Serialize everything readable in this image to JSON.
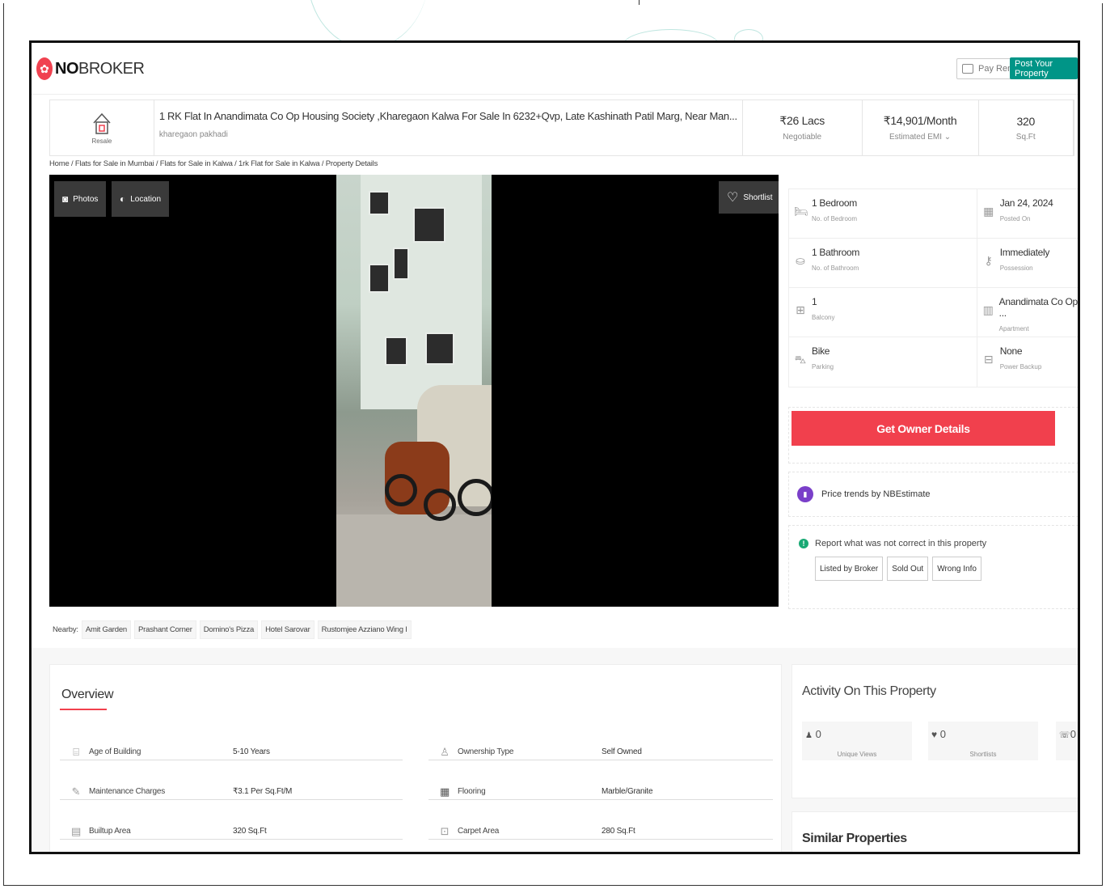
{
  "header": {
    "logo_bold": "NO",
    "logo_rest": "BROKER",
    "pay_rent": "Pay Rent",
    "post_property": "Post Your Property"
  },
  "titlebar": {
    "type_label": "Resale",
    "title": "1 RK Flat In Anandimata Co Op Housing Society ,Kharegaon Kalwa For Sale In 6232+Qvp, Late Kashinath Patil Marg, Near Man...",
    "locality": "kharegaon pakhadi",
    "price": "₹26 Lacs",
    "price_note": "Negotiable",
    "emi": "₹14,901/Month",
    "emi_note": "Estimated EMI ⌄",
    "area": "320",
    "area_unit": "Sq.Ft"
  },
  "breadcrumb": "Home / Flats for Sale in Mumbai / Flats for Sale in Kalwa / 1rk Flat for Sale in Kalwa / Property Details",
  "gallery": {
    "photos_label": "Photos",
    "location_label": "Location",
    "shortlist_label": "Shortlist"
  },
  "nearby": {
    "label": "Nearby:",
    "places": [
      "Amit Garden",
      "Prashant Corner",
      "Domino's Pizza",
      "Hotel Sarovar",
      "Rustomjee Azziano Wing I"
    ]
  },
  "details": [
    {
      "left": {
        "value": "1 Bedroom",
        "label": "No. of Bedroom",
        "icon": "bed-icon"
      },
      "right": {
        "value": "Jan 24, 2024",
        "label": "Posted On",
        "icon": "calendar-icon"
      }
    },
    {
      "left": {
        "value": "1 Bathroom",
        "label": "No. of Bathroom",
        "icon": "bath-icon"
      },
      "right": {
        "value": "Immediately",
        "label": "Possession",
        "icon": "key-icon"
      }
    },
    {
      "left": {
        "value": "1",
        "label": "Balcony",
        "icon": "balcony-icon"
      },
      "right": {
        "value": "Anandimata Co Op ...",
        "label": "Apartment",
        "icon": "building-icon"
      }
    },
    {
      "left": {
        "value": "Bike",
        "label": "Parking",
        "icon": "car-icon"
      },
      "right": {
        "value": "None",
        "label": "Power Backup",
        "icon": "battery-icon"
      }
    }
  ],
  "cta": {
    "get_owner": "Get Owner Details",
    "price_trends": "Price trends by NBEstimate"
  },
  "report": {
    "title": "Report what was not correct in this property",
    "options": [
      "Listed by Broker",
      "Sold Out",
      "Wrong Info"
    ]
  },
  "overview": {
    "title": "Overview",
    "rows": [
      {
        "label": "Age of Building",
        "value": "5-10 Years",
        "icon": "building-age-icon"
      },
      {
        "label": "Ownership Type",
        "value": "Self Owned",
        "icon": "ownership-icon"
      },
      {
        "label": "Maintenance Charges",
        "value": "₹3.1 Per Sq.Ft/M",
        "icon": "maintenance-icon"
      },
      {
        "label": "Flooring",
        "value": "Marble/Granite",
        "icon": "flooring-icon"
      },
      {
        "label": "Builtup Area",
        "value": "320 Sq.Ft",
        "icon": "builtup-icon"
      },
      {
        "label": "Carpet Area",
        "value": "280 Sq.Ft",
        "icon": "carpet-icon"
      }
    ]
  },
  "activity": {
    "title": "Activity On This Property",
    "stats": [
      {
        "count": "0",
        "label": "Unique Views",
        "icon": "user-icon"
      },
      {
        "count": "0",
        "label": "Shortlists",
        "icon": "heart-icon"
      },
      {
        "count": "0",
        "label": "",
        "icon": "phone-icon"
      }
    ]
  },
  "similar": {
    "title": "Similar Properties"
  },
  "colors": {
    "brand_red": "#f1404d",
    "brand_teal": "#009587",
    "trend_purple": "#7a3fc9",
    "report_green": "#19a974"
  }
}
